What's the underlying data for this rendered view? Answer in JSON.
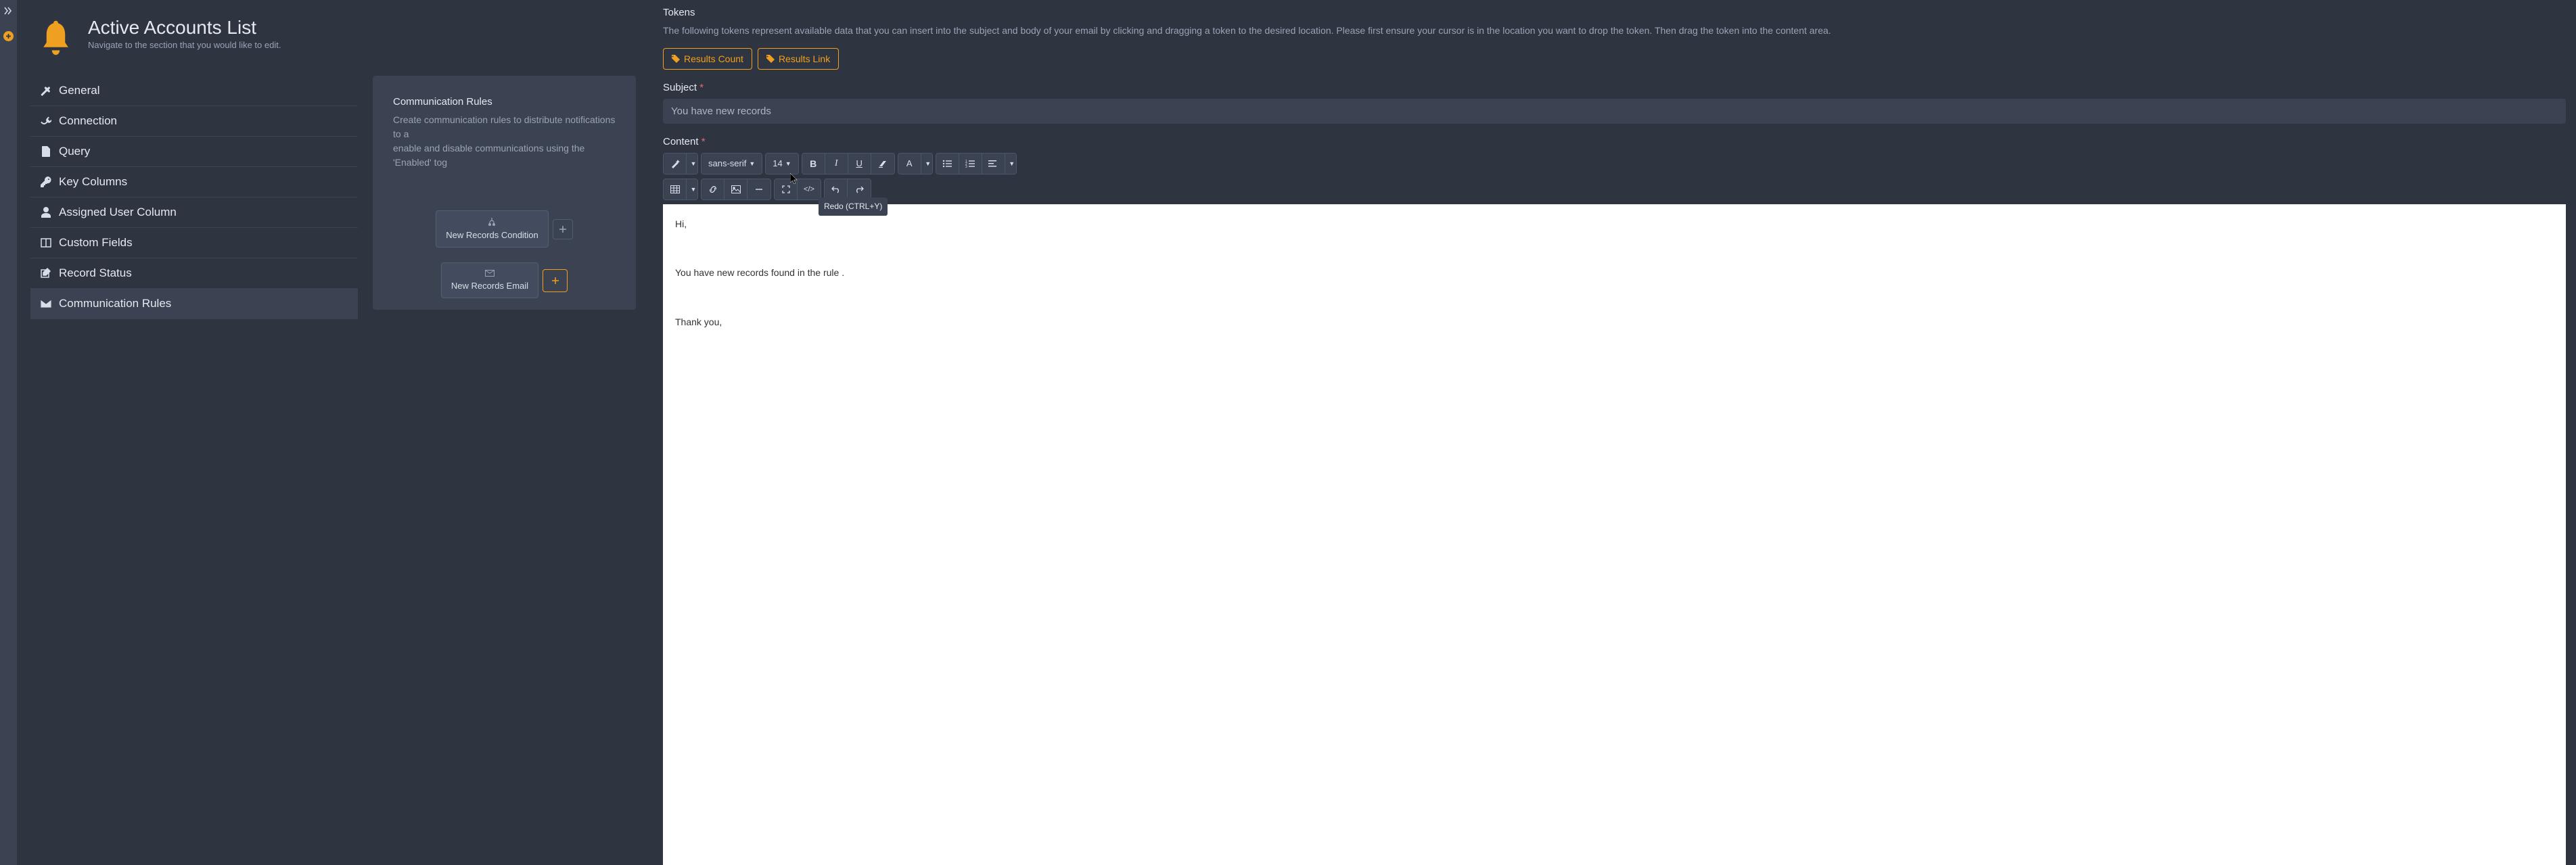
{
  "header": {
    "title": "Active Accounts List",
    "subtitle": "Navigate to the section that you would like to edit."
  },
  "nav": {
    "items": [
      {
        "label": "General"
      },
      {
        "label": "Connection"
      },
      {
        "label": "Query"
      },
      {
        "label": "Key Columns"
      },
      {
        "label": "Assigned User Column"
      },
      {
        "label": "Custom Fields"
      },
      {
        "label": "Record Status"
      },
      {
        "label": "Communication Rules"
      }
    ]
  },
  "canvas": {
    "title": "Communication Rules",
    "desc_line1": "Create communication rules to distribute notifications to a",
    "desc_line2": "enable and disable communications using the 'Enabled' tog",
    "node_condition": "New Records Condition",
    "node_email": "New Records Email"
  },
  "right": {
    "tokens_label": "Tokens",
    "tokens_help": "The following tokens represent available data that you can insert into the subject and body of your email by clicking and dragging a token to the desired location. Please first ensure your cursor is in the location you want to drop the token. Then drag the token into the content area.",
    "token_results_count": "Results Count",
    "token_results_link": "Results Link",
    "subject_label": "Subject",
    "subject_value": "You have new records",
    "content_label": "Content",
    "font_family": "sans-serif",
    "font_size": "14",
    "tooltip": "Redo (CTRL+Y)",
    "body_p1": "Hi,",
    "body_p2": "You have  new records found in the rule .",
    "body_p3": "Thank you,"
  }
}
